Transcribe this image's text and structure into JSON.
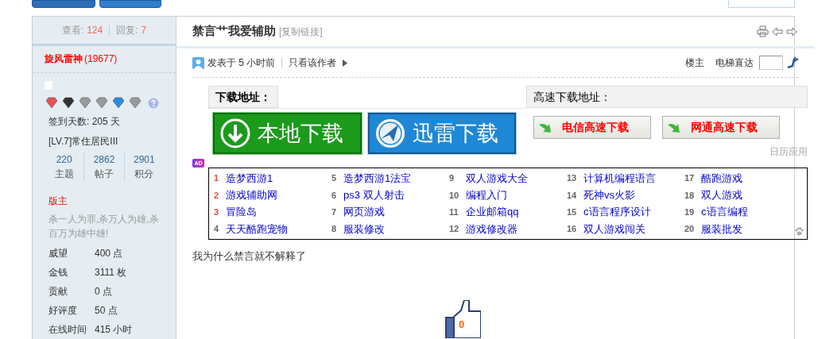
{
  "header_stats": {
    "views_label": "查看:",
    "views": "124",
    "replies_label": "回复:",
    "replies": "7"
  },
  "author": {
    "name": "旋风雷神",
    "uid": "(19677)",
    "medals": [
      {
        "color": "#e8505a"
      },
      {
        "color": "#333333"
      },
      {
        "color": "#9a9a9a"
      },
      {
        "color": "#9a9a9a"
      },
      {
        "color": "#2a8ce0"
      },
      {
        "color": "#9a9a9a"
      }
    ],
    "signin": "签到天数: 205 天",
    "level": "[LV.7]常住居民III",
    "stats": [
      {
        "value": "220",
        "label": "主题"
      },
      {
        "value": "2862",
        "label": "帖子"
      },
      {
        "value": "2901",
        "label": "积分"
      }
    ],
    "role": "版主",
    "motto": "杀一人为罪,杀万人为雄,杀百万为雄中雄!",
    "fields": [
      {
        "label": "威望",
        "value": "400 点"
      },
      {
        "label": "金钱",
        "value": "3111 枚"
      },
      {
        "label": "贡献",
        "value": "0 点"
      },
      {
        "label": "好评度",
        "value": "50 点"
      },
      {
        "label": "在线时间",
        "value": "415 小时"
      }
    ]
  },
  "thread": {
    "title": "禁言艹我爱辅助",
    "copy_link": "[复制链接]"
  },
  "post": {
    "posted": "发表于 5 小时前",
    "only_author": "只看该作者",
    "floor": "楼主",
    "jump_label": "电梯直达",
    "download": {
      "local_header": "下载地址：",
      "fast_header": "高速下载地址：",
      "local_button": "本地下载",
      "thunder_button": "迅雷下载",
      "telecom_button": "电信高速下载",
      "netcom_button": "网通高速下载",
      "calendar": "日历应用"
    },
    "ad_badge": "AD",
    "ad_links": [
      {
        "num": "1",
        "text": "造梦西游1",
        "hot": true
      },
      {
        "num": "2",
        "text": "游戏辅助网",
        "hot": true
      },
      {
        "num": "3",
        "text": "冒险岛",
        "hot": true
      },
      {
        "num": "4",
        "text": "天天酷跑宠物",
        "hot": false
      },
      {
        "num": "5",
        "text": "造梦西游1法宝",
        "hot": false
      },
      {
        "num": "6",
        "text": "ps3 双人射击",
        "hot": false
      },
      {
        "num": "7",
        "text": "网页游戏",
        "hot": false
      },
      {
        "num": "8",
        "text": "服装修改",
        "hot": false
      },
      {
        "num": "9",
        "text": "双人游戏大全",
        "hot": false
      },
      {
        "num": "10",
        "text": "编程入门",
        "hot": false
      },
      {
        "num": "11",
        "text": "企业邮箱qq",
        "hot": false
      },
      {
        "num": "12",
        "text": "游戏修改器",
        "hot": false
      },
      {
        "num": "13",
        "text": "计算机编程语言",
        "hot": false
      },
      {
        "num": "14",
        "text": "死神vs火影",
        "hot": false
      },
      {
        "num": "15",
        "text": "c语言程序设计",
        "hot": false
      },
      {
        "num": "16",
        "text": "双人游戏闯关",
        "hot": false
      },
      {
        "num": "17",
        "text": "酷跑游戏",
        "hot": false
      },
      {
        "num": "18",
        "text": "双人游戏",
        "hot": false
      },
      {
        "num": "19",
        "text": "c语言编程",
        "hot": false
      },
      {
        "num": "20",
        "text": "服装批发",
        "hot": false
      }
    ],
    "body": "我为什么禁言就不解释了",
    "likes": "0"
  }
}
